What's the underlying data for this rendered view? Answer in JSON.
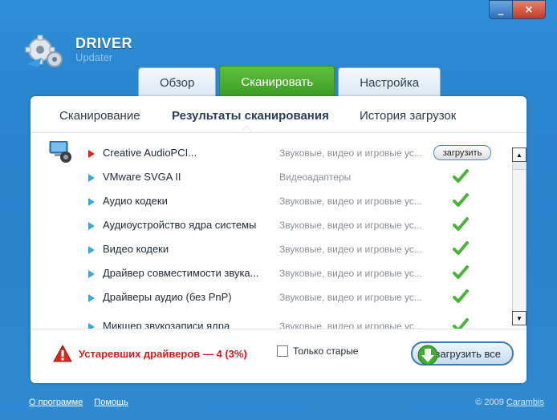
{
  "window": {
    "minimize": "_",
    "close": "×"
  },
  "logo": {
    "title": "DRIVER",
    "subtitle": "Updater"
  },
  "tabs": [
    {
      "label": "Обзор",
      "active": false
    },
    {
      "label": "Сканировать",
      "active": true
    },
    {
      "label": "Настройка",
      "active": false
    }
  ],
  "subtabs": [
    {
      "label": "Сканирование",
      "active": false
    },
    {
      "label": "Результаты сканирования",
      "active": true
    },
    {
      "label": "История загрузок",
      "active": false
    }
  ],
  "drivers": [
    {
      "name": "Creative AudioPCI...",
      "category": "Звуковые, видео и игровые ус...",
      "status": "outdated",
      "action": "загрузить"
    },
    {
      "name": "VMware SVGA II",
      "category": "Видеоадаптеры",
      "status": "ok"
    },
    {
      "name": "Аудио кодеки",
      "category": "Звуковые, видео и игровые ус...",
      "status": "ok"
    },
    {
      "name": "Аудиоустройство ядра системы",
      "category": "Звуковые, видео и игровые ус...",
      "status": "ok"
    },
    {
      "name": "Видео кодеки",
      "category": "Звуковые, видео и игровые ус...",
      "status": "ok"
    },
    {
      "name": "Драйвер совместимости звука...",
      "category": "Звуковые, видео и игровые ус...",
      "status": "ok"
    },
    {
      "name": "Драйверы аудио (без PnP)",
      "category": "Звуковые, видео и игровые ус...",
      "status": "ok"
    },
    {
      "name": "Микшер звукозаписи ядра",
      "category": "Звуковые, видео и игровые ус...",
      "status": "ok"
    }
  ],
  "warning": {
    "text": "Устаревших драйверов — 4 (3%)"
  },
  "only_old": {
    "label": "Только старые",
    "checked": false
  },
  "download_all": {
    "label": "загрузить все"
  },
  "footer": {
    "about": "О программе",
    "help": "Помощь",
    "copyright": "© 2009",
    "brand": "Carambis"
  },
  "colors": {
    "accent_green": "#3d9c24",
    "window_blue": "#2a86cf",
    "warning_red": "#d01e1e"
  }
}
